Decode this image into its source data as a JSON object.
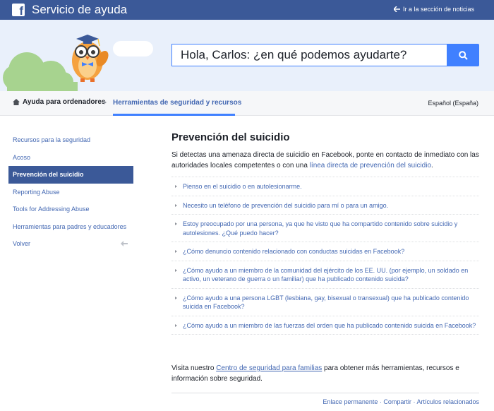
{
  "header": {
    "app_title": "Servicio de ayuda",
    "news_link": "Ir a la sección de noticias"
  },
  "search": {
    "value": "Hola, Carlos: ¿en qué podemos ayudarte?"
  },
  "breadcrumb": {
    "home": "Ayuda para ordenadores",
    "current": "Herramientas de seguridad y recursos",
    "language": "Español (España)"
  },
  "sidebar": {
    "items": [
      {
        "label": "Recursos para la seguridad"
      },
      {
        "label": "Acoso"
      },
      {
        "label": "Prevención del suicidio"
      },
      {
        "label": "Reporting Abuse"
      },
      {
        "label": "Tools for Addressing Abuse"
      },
      {
        "label": "Herramientas para padres y educadores"
      },
      {
        "label": "Volver"
      }
    ]
  },
  "article": {
    "title": "Prevención del suicidio",
    "intro_text": "Si detectas una amenaza directa de suicidio en Facebook, ponte en contacto de inmediato con las autoridades locales competentes o con una ",
    "intro_link": "línea directa de prevención del suicidio",
    "intro_end": ".",
    "questions": [
      "Pienso en el suicidio o en autolesionarme.",
      "Necesito un teléfono de prevención del suicidio para mí o para un amigo.",
      "Estoy preocupado por una persona, ya que he visto que ha compartido contenido sobre suicidio y autolesiones. ¿Qué puedo hacer?",
      "¿Cómo denuncio contenido relacionado con conductas suicidas en Facebook?",
      "¿Cómo ayudo a un miembro de la comunidad del ejército de los EE. UU. (por ejemplo, un soldado en activo, un veterano de guerra o un familiar) que ha publicado contenido suicida?",
      "¿Cómo ayudo a una persona LGBT (lesbiana, gay, bisexual o transexual) que ha publicado contenido suicida en Facebook?",
      "¿Cómo ayudo a un miembro de las fuerzas del orden que ha publicado contenido suicida en Facebook?"
    ],
    "outro_before": "Visita nuestro ",
    "outro_link": "Centro de seguridad para familias",
    "outro_after": " para obtener más herramientas, recursos e información sobre seguridad."
  },
  "footer": {
    "permalink": "Enlace permanente",
    "share": "Compartir",
    "related": "Artículos relacionados",
    "separator": " · "
  },
  "colors": {
    "brand": "#3b5998",
    "accent": "#4080ff",
    "link": "#4267b2"
  }
}
